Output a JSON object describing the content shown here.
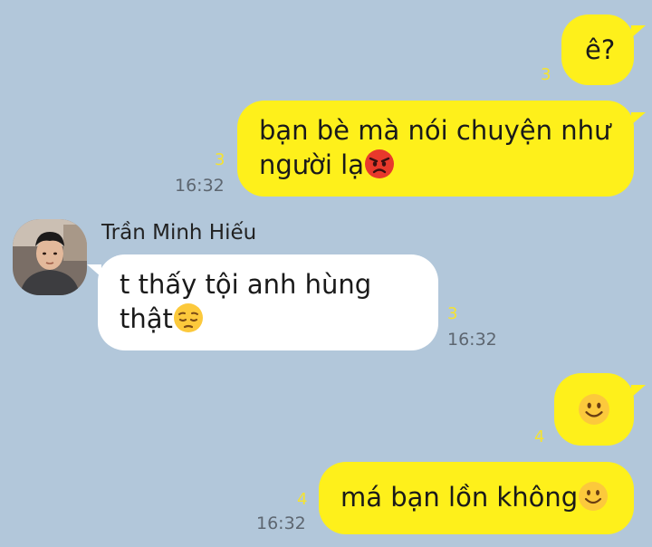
{
  "colors": {
    "background": "#b2c7da",
    "my_bubble": "#fef01b",
    "other_bubble": "#ffffff",
    "unread_count": "#f5e330",
    "timestamp": "#5d6670"
  },
  "messages": [
    {
      "from": "me",
      "text": "ê?",
      "unread": "3",
      "time": ""
    },
    {
      "from": "me",
      "text_line1": "bạn bè mà nói chuyện như",
      "text_line2": "người lạ",
      "emoji": "angry-face-emoji",
      "unread": "3",
      "time": "16:32"
    },
    {
      "from": "other",
      "sender": "Trần Minh Hiếu",
      "avatar": "profile-photo",
      "text_line1": "t thấy tội anh hùng",
      "text_line2": "thật",
      "emoji": "pensive-face-emoji",
      "unread": "3",
      "time": "16:32"
    },
    {
      "from": "me",
      "text": "",
      "emoji": "slightly-smiling-face-emoji",
      "unread": "4",
      "time": ""
    },
    {
      "from": "me",
      "text": "má bạn lồn không",
      "emoji": "slightly-smiling-face-emoji",
      "unread": "4",
      "time": "16:32"
    }
  ]
}
